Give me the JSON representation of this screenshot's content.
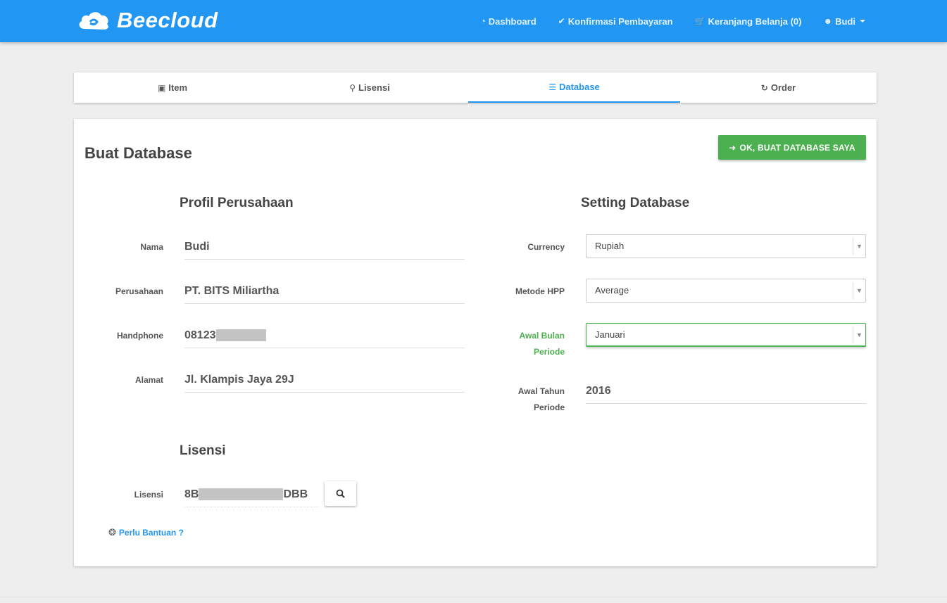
{
  "brand": {
    "name": "Beecloud"
  },
  "nav": {
    "dashboard": "Dashboard",
    "confirm_payment": "Konfirmasi Pembayaran",
    "cart": "Keranjang Belanja (0)",
    "user": "Budi"
  },
  "tabs": [
    {
      "label": "Item"
    },
    {
      "label": "Lisensi"
    },
    {
      "label": "Database"
    },
    {
      "label": "Order"
    }
  ],
  "page": {
    "title": "Buat Database",
    "submit_label": "OK, BUAT DATABASE SAYA"
  },
  "profile": {
    "title": "Profil Perusahaan",
    "name_label": "Nama",
    "name_value": "Budi",
    "company_label": "Perusahaan",
    "company_value": "PT. BITS Miliartha",
    "phone_label": "Handphone",
    "phone_value": "08123",
    "address_label": "Alamat",
    "address_value": "Jl. Klampis Jaya 29J"
  },
  "license": {
    "title": "Lisensi",
    "label": "Lisensi",
    "value_prefix": "8B",
    "value_suffix": "DBB"
  },
  "settings": {
    "title": "Setting Database",
    "currency_label": "Currency",
    "currency_value": "Rupiah",
    "hpp_label": "Metode HPP",
    "hpp_value": "Average",
    "start_month_label_1": "Awal Bulan",
    "start_month_label_2": "Periode",
    "start_month_value": "Januari",
    "start_year_label_1": "Awal Tahun",
    "start_year_label_2": "Periode",
    "start_year_value": "2016"
  },
  "help": {
    "label": "Perlu Bantuan ?"
  },
  "colors": {
    "primary": "#2196f3",
    "success": "#4caf50"
  }
}
